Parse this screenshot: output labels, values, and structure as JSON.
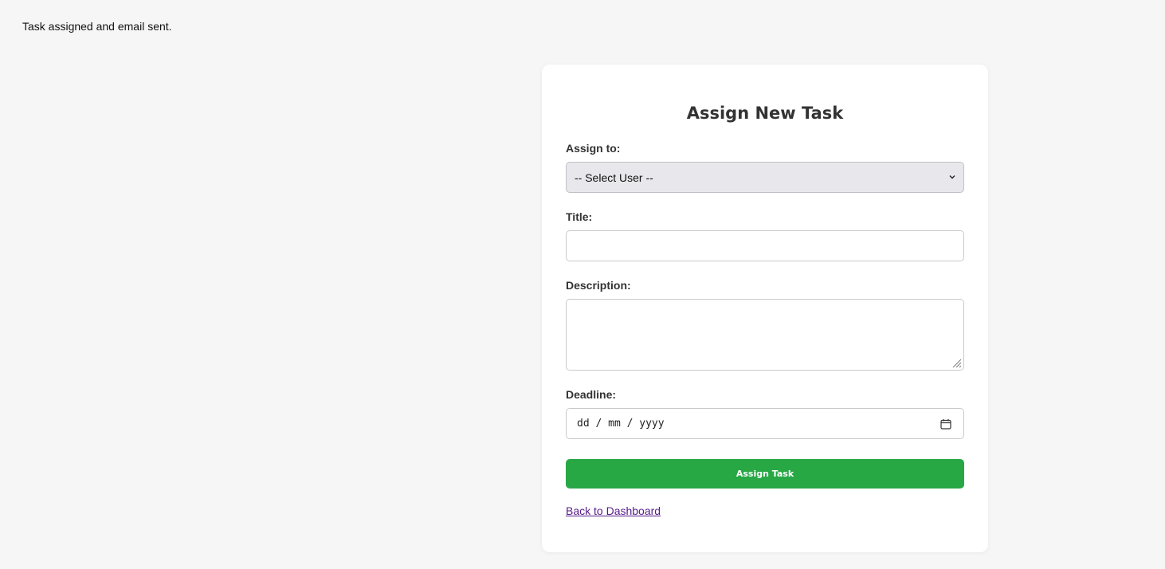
{
  "flash_message": "Task assigned and email sent.",
  "form": {
    "title": "Assign New Task",
    "assign_label": "Assign to:",
    "assign_selected": "-- Select User --",
    "title_label": "Title:",
    "title_value": "",
    "description_label": "Description:",
    "description_value": "",
    "deadline_label": "Deadline:",
    "deadline_placeholder": "dd / mm / yyyy",
    "submit_label": "Assign Task",
    "back_link": "Back to Dashboard"
  },
  "icons": {
    "select_arrow": "chevron-down-icon",
    "date_picker": "calendar-icon",
    "resize": "resize-grip-icon"
  },
  "colors": {
    "page_bg": "#f6f6f6",
    "card_bg": "#ffffff",
    "button": "#28a745",
    "link": "#551a8b",
    "select_bg": "#e8e8ec"
  }
}
